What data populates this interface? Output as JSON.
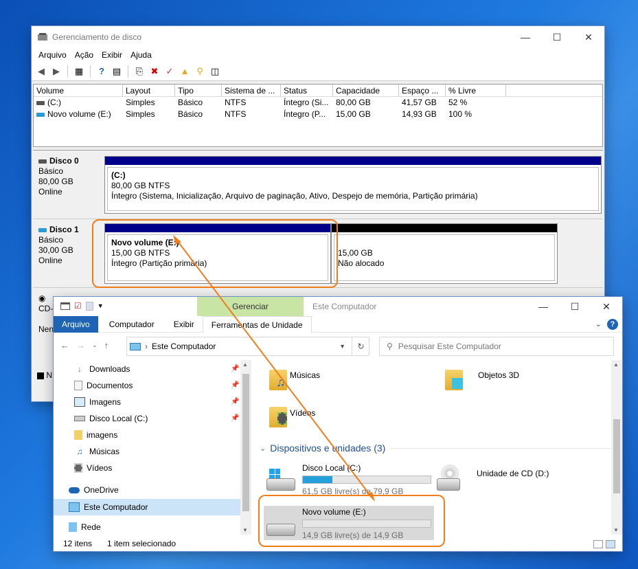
{
  "disk_mgmt": {
    "title": "Gerenciamento de disco",
    "menu": [
      "Arquivo",
      "Ação",
      "Exibir",
      "Ajuda"
    ],
    "columns": [
      "Volume",
      "Layout",
      "Tipo",
      "Sistema de ...",
      "Status",
      "Capacidade",
      "Espaço ...",
      "% Livre"
    ],
    "volumes": [
      {
        "volume": "(C:)",
        "layout": "Simples",
        "tipo": "Básico",
        "sistema": "NTFS",
        "status": "Íntegro (Si...",
        "capacidade": "80,00 GB",
        "espaco": "41,57 GB",
        "livre": "52 %"
      },
      {
        "volume": "Novo volume (E:)",
        "layout": "Simples",
        "tipo": "Básico",
        "sistema": "NTFS",
        "status": "Íntegro (P...",
        "capacidade": "15,00 GB",
        "espaco": "14,93 GB",
        "livre": "100 %"
      }
    ],
    "disk0": {
      "name": "Disco 0",
      "type": "Básico",
      "size": "80,00 GB",
      "state": "Online",
      "part": {
        "label": "(C:)",
        "size": "80,00 GB NTFS",
        "status": "Íntegro (Sistema, Inicialização, Arquivo de paginação, Ativo, Despejo de memória, Partição primária)"
      }
    },
    "disk1": {
      "name": "Disco 1",
      "type": "Básico",
      "size": "30,00 GB",
      "state": "Online",
      "part1": {
        "label": "Novo volume  (E:)",
        "size": "15,00 GB NTFS",
        "status": "Íntegro (Partição primária)"
      },
      "part2": {
        "size": "15,00 GB",
        "status": "Não alocado"
      }
    },
    "cd_label": "CD-",
    "n_label": "Nen",
    "legend_label": "N"
  },
  "explorer": {
    "manage_tab": "Gerenciar",
    "title": "Este Computador",
    "tabs": [
      "Arquivo",
      "Computador",
      "Exibir",
      "Ferramentas de Unidade"
    ],
    "address": "Este Computador",
    "search_placeholder": "Pesquisar Este Computador",
    "nav": [
      "Downloads",
      "Documentos",
      "Imagens",
      "Disco Local (C:)",
      "imagens",
      "Músicas",
      "Vídeos",
      "OneDrive",
      "Este Computador",
      "Rede"
    ],
    "folders": [
      "Músicas",
      "Objetos 3D",
      "Vídeos"
    ],
    "group": "Dispositivos e unidades (3)",
    "drives": [
      {
        "name": "Disco Local (C:)",
        "free": "61,5 GB livre(s) de 79,9 GB",
        "used_fraction": 0.23
      },
      {
        "name": "Unidade de CD (D:)"
      },
      {
        "name": "Novo volume (E:)",
        "free": "14,9 GB livre(s) de 14,9 GB",
        "used_fraction": 0.0
      }
    ],
    "status_count": "12 itens",
    "status_sel": "1 item selecionado"
  },
  "colors": {
    "accent": "#1e63b4",
    "highlight": "#f07d1a",
    "partition_bar": "#00008b"
  }
}
